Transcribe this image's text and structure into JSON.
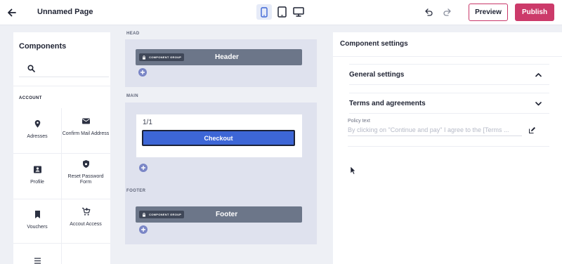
{
  "topbar": {
    "page_title": "Unnamed Page",
    "preview_label": "Preview",
    "publish_label": "Publish",
    "active_device": "mobile",
    "icons": [
      "back-arrow-icon",
      "mobile-icon",
      "tablet-icon",
      "desktop-icon",
      "undo-icon",
      "redo-icon"
    ],
    "accent_color": "#cc3a6a"
  },
  "components_panel": {
    "title": "Components",
    "search_placeholder": "",
    "section": "ACCOUNT",
    "items": [
      {
        "label": "Adresses",
        "icon": "location-pin-icon"
      },
      {
        "label": "Confirm Mail Address",
        "icon": "mail-icon"
      },
      {
        "label": "Profile",
        "icon": "profile-card-icon"
      },
      {
        "label": "Reset Password Form",
        "icon": "shield-lock-icon"
      },
      {
        "label": "Vouchers",
        "icon": "bookmark-icon"
      },
      {
        "label": "Accout Access",
        "icon": "cart-add-icon"
      }
    ]
  },
  "canvas": {
    "sections": [
      "HEAD",
      "MAIN",
      "FOOTER"
    ],
    "header_slot": {
      "tag": "COMPONENT GROUP",
      "title": "Header"
    },
    "main": {
      "counter": "1/1",
      "button": "Checkout",
      "button_color": "#3d66d6"
    },
    "footer_slot": {
      "tag": "COMPONENT GROUP",
      "title": "Footer"
    }
  },
  "settings_panel": {
    "title": "Component settings",
    "general_label": "General settings",
    "terms_label": "Terms and agreements",
    "field_label": "Policy text",
    "field_value": "By clicking on \"Continue and pay\" I agree to the [Terms ..."
  }
}
